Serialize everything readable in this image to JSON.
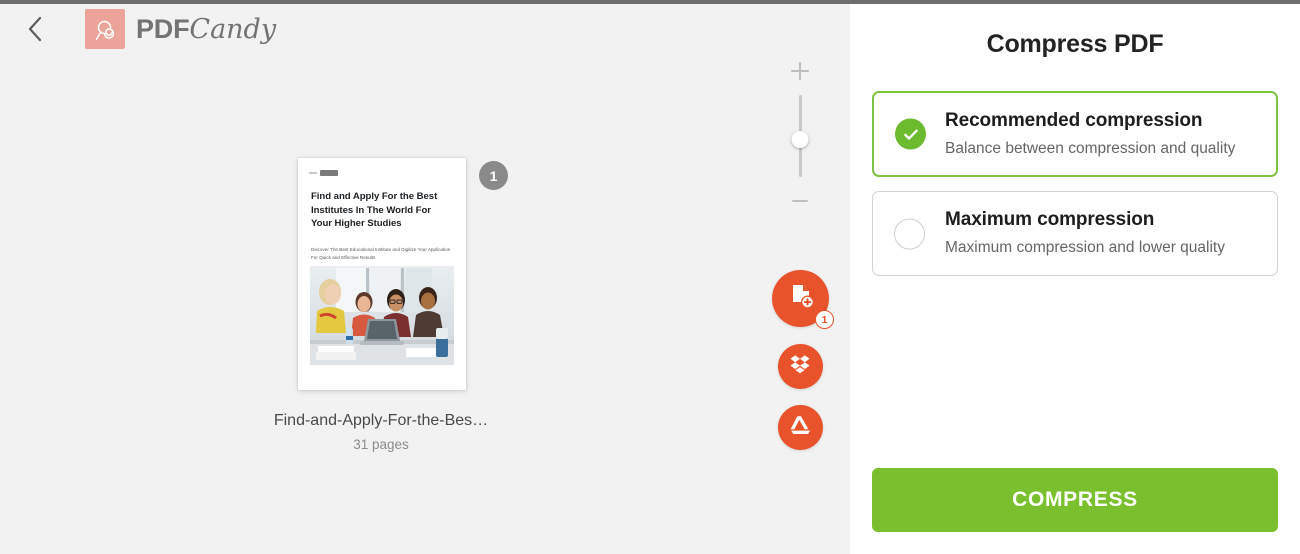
{
  "brand": {
    "name_bold": "PDF",
    "name_script": "Candy",
    "logo_icon": "lollipop-icon",
    "back_icon": "chevron-left-icon"
  },
  "workspace": {
    "document": {
      "badge_number": "1",
      "file_name": "Find-and-Apply-For-the-Bes…",
      "page_count": "31 pages",
      "preview": {
        "title": "Find and Apply For the Best Institutes In The World For Your Higher Studies",
        "subtitle": "Discover The Best Educational Institute and Digitize Your Application For Quick and Effective Results"
      }
    },
    "zoom_control": {
      "increase_icon": "plus-icon",
      "decrease_icon": "minus-icon",
      "handle_label": "zoom-slider-handle"
    },
    "source_buttons": [
      {
        "name": "add-file-button",
        "icon": "file-plus-icon",
        "badge": "1"
      },
      {
        "name": "dropbox-button",
        "icon": "dropbox-icon",
        "badge": ""
      },
      {
        "name": "google-drive-button",
        "icon": "google-drive-icon",
        "badge": ""
      }
    ]
  },
  "panel": {
    "title": "Compress PDF",
    "options": [
      {
        "id": "recommended",
        "title": "Recommended compression",
        "description": "Balance between compression and quality",
        "selected": true
      },
      {
        "id": "maximum",
        "title": "Maximum compression",
        "description": "Maximum compression and lower quality",
        "selected": false
      }
    ],
    "primary_action": "COMPRESS"
  },
  "colors": {
    "accent_orange": "#e8532b",
    "accent_green": "#7ac02e",
    "selected_border_green": "#7fc241",
    "brand_pink": "#eca399",
    "workspace_bg": "#f2f2f2",
    "panel_bg": "#ffffff"
  }
}
